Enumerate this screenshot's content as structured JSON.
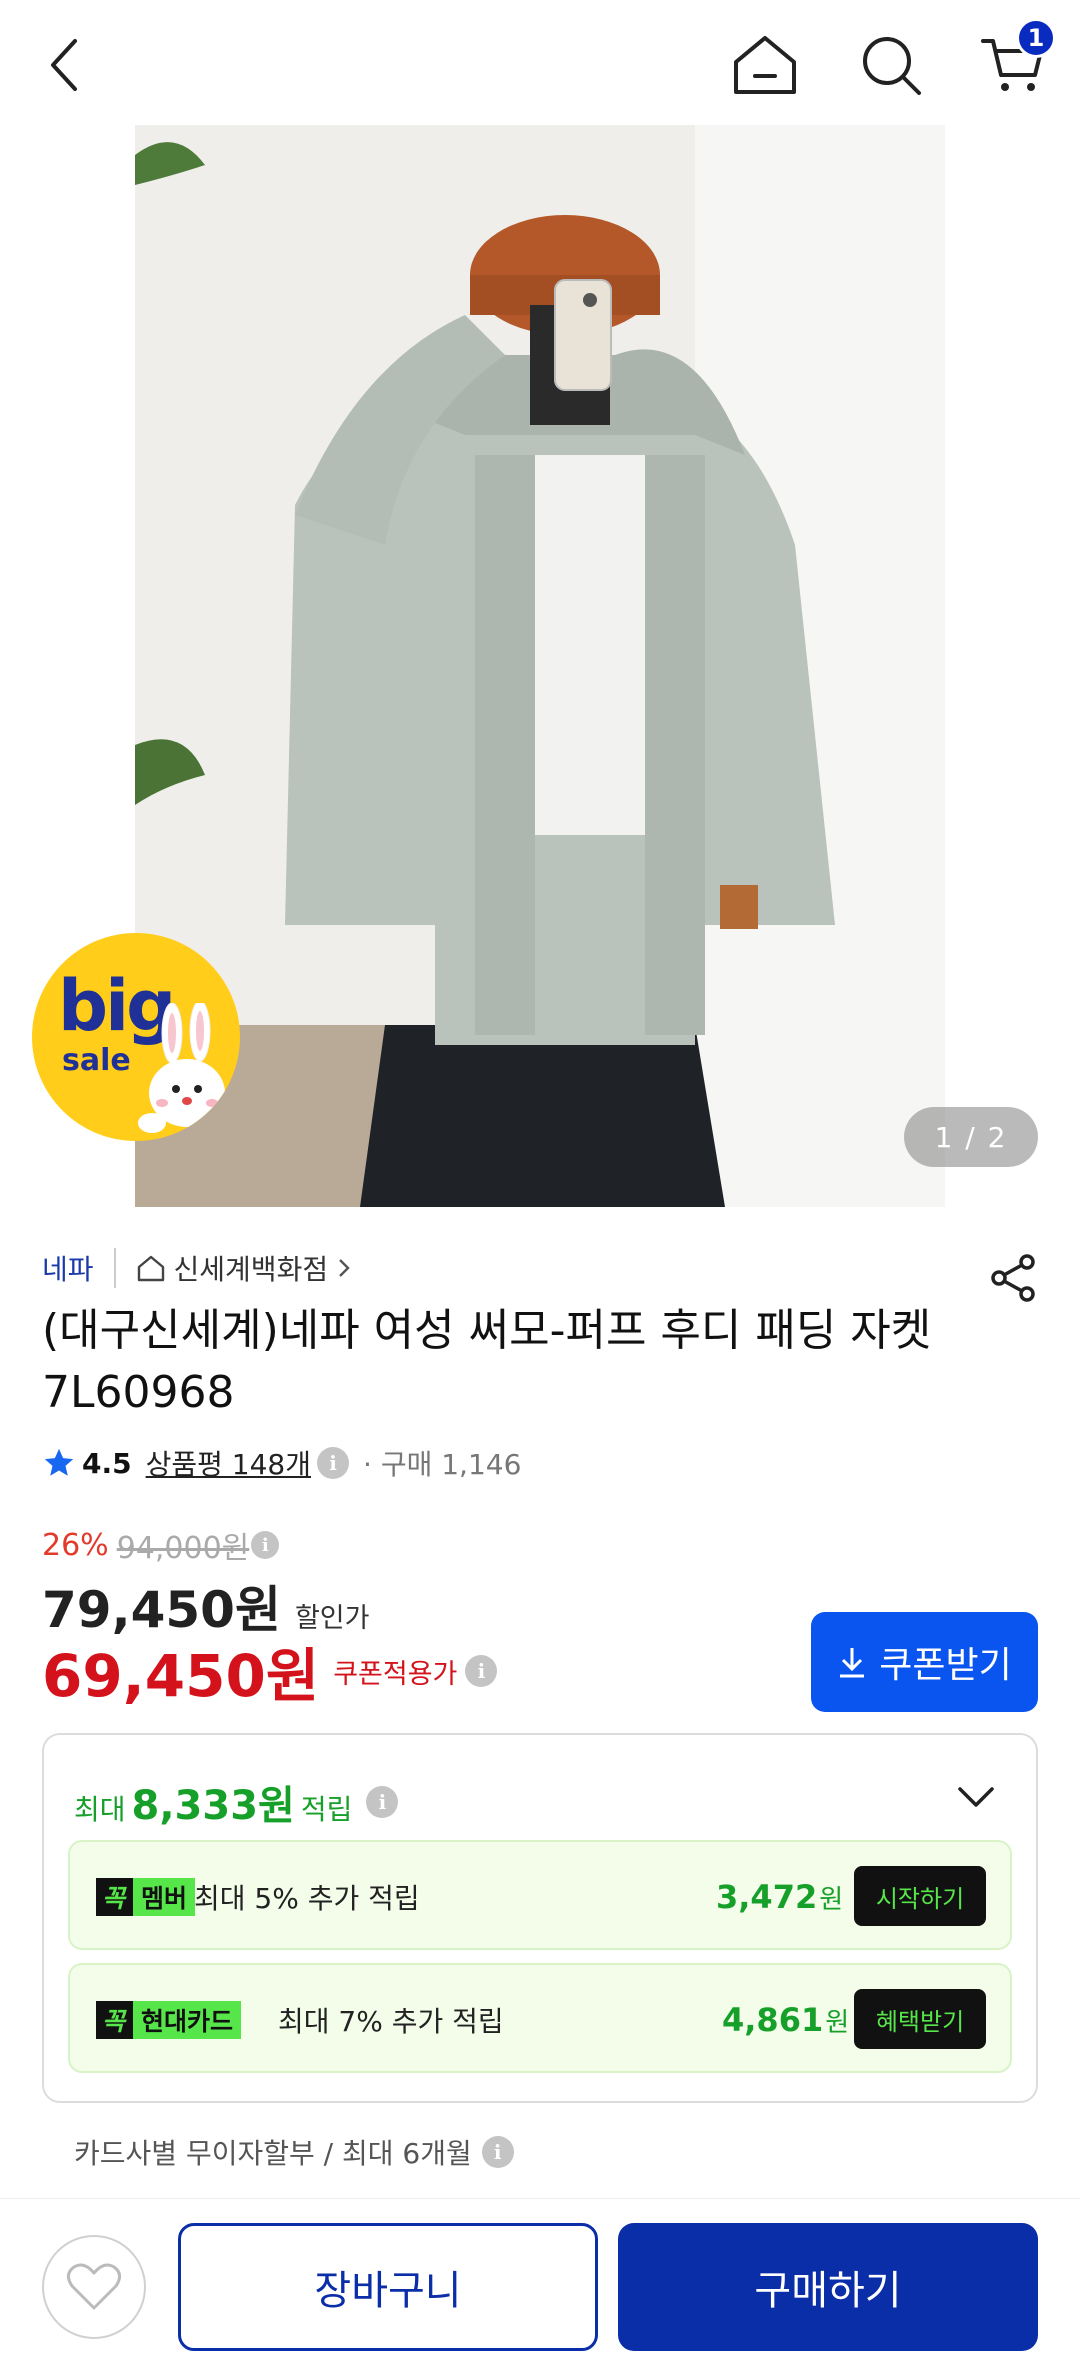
{
  "topbar": {
    "cart_count": "1"
  },
  "hero": {
    "counter": "1 / 2",
    "badge_big": "big",
    "badge_small": "sale"
  },
  "product": {
    "brand": "네파",
    "store": "신세계백화점",
    "title": "(대구신세계)네파 여성 써모-퍼프 후디 패딩 자켓 7L60968",
    "rating": "4.5",
    "reviews": "상품평 148개",
    "purchase": "구매 1,146"
  },
  "price": {
    "discount_rate": "26%",
    "original": "94,000원",
    "sale": "79,450원",
    "sale_label": "할인가",
    "coupon": "69,450원",
    "coupon_label": "쿠폰적용가",
    "coupon_button": "쿠폰받기"
  },
  "points": {
    "prefix": "최대",
    "amount": "8,333원",
    "suffix": "적립",
    "benefits": [
      {
        "tag_k": "꼭",
        "tag_name": "멤버",
        "text": "최대 5% 추가 적립",
        "amount": "3,472",
        "unit": "원",
        "button": "시작하기"
      },
      {
        "tag_k": "꼭",
        "tag_name": "현대카드",
        "text": "최대 7% 추가 적립",
        "amount": "4,861",
        "unit": "원",
        "button": "혜택받기"
      }
    ]
  },
  "installment": "카드사별 무이자할부 / 최대 6개월",
  "bottom": {
    "cart": "장바구니",
    "buy": "구매하기"
  },
  "colors": {
    "brand_blue": "#0a2da8",
    "coupon_blue": "#0a55f0",
    "price_red": "#d4121b",
    "points_green": "#16a02a"
  }
}
